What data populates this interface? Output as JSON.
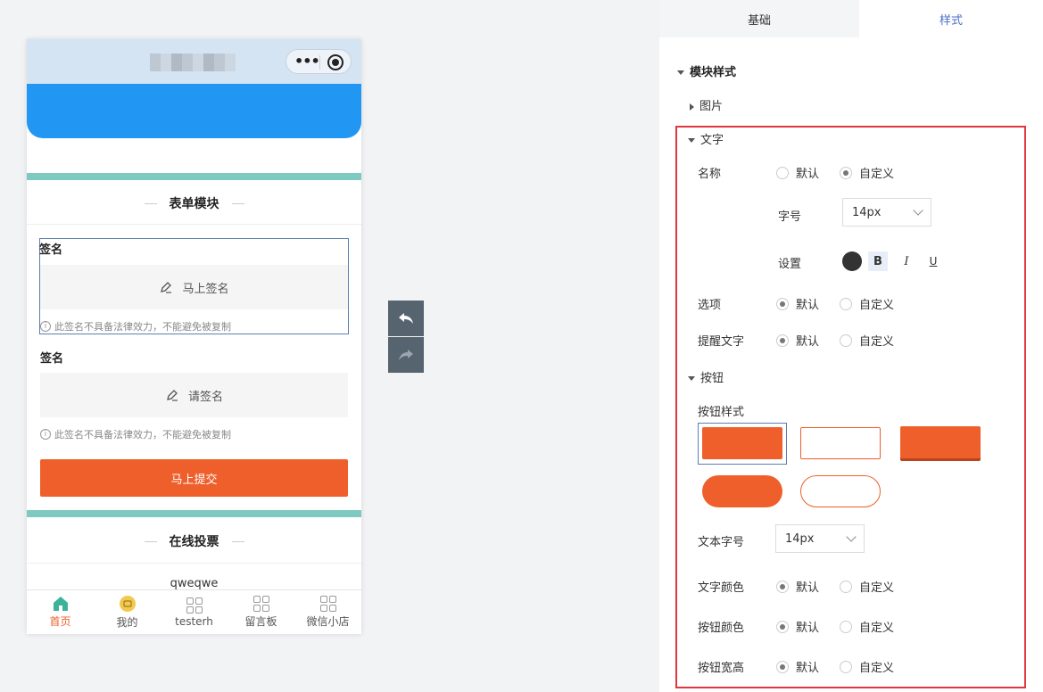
{
  "phone": {
    "form_title": "表单模块",
    "field1": {
      "label": "签名",
      "button": "马上签名",
      "note": "此签名不具备法律效力，不能避免被复制"
    },
    "field2": {
      "label": "签名",
      "button": "请签名",
      "note": "此签名不具备法律效力，不能避免被复制"
    },
    "submit": "马上提交",
    "poll_title": "在线投票",
    "poll_item": "qweqwe",
    "tabs": [
      "首页",
      "我的",
      "testerh",
      "留言板",
      "微信小店"
    ]
  },
  "panel": {
    "tabs": {
      "basic": "基础",
      "style": "样式"
    },
    "module_style": "模块样式",
    "image": "图片",
    "text": {
      "heading": "文字",
      "name_label": "名称",
      "default": "默认",
      "custom": "自定义",
      "size_label": "字号",
      "size_value": "14px",
      "settings_label": "设置",
      "bold": "B",
      "italic": "I",
      "underline": "U",
      "option_label": "选项",
      "hint_label": "提醒文字"
    },
    "button": {
      "heading": "按钮",
      "style_label": "按钮样式",
      "text_size_label": "文本字号",
      "text_size_value": "14px",
      "text_color_label": "文字颜色",
      "btn_color_label": "按钮颜色",
      "btn_size_label": "按钮宽高",
      "default": "默认",
      "custom": "自定义"
    }
  },
  "colors": {
    "accent": "#ee5f2b",
    "banner": "#2196f3",
    "teal": "#7fcac0",
    "highlight": "#e0363e",
    "tab_active": "#4a6fc8"
  }
}
